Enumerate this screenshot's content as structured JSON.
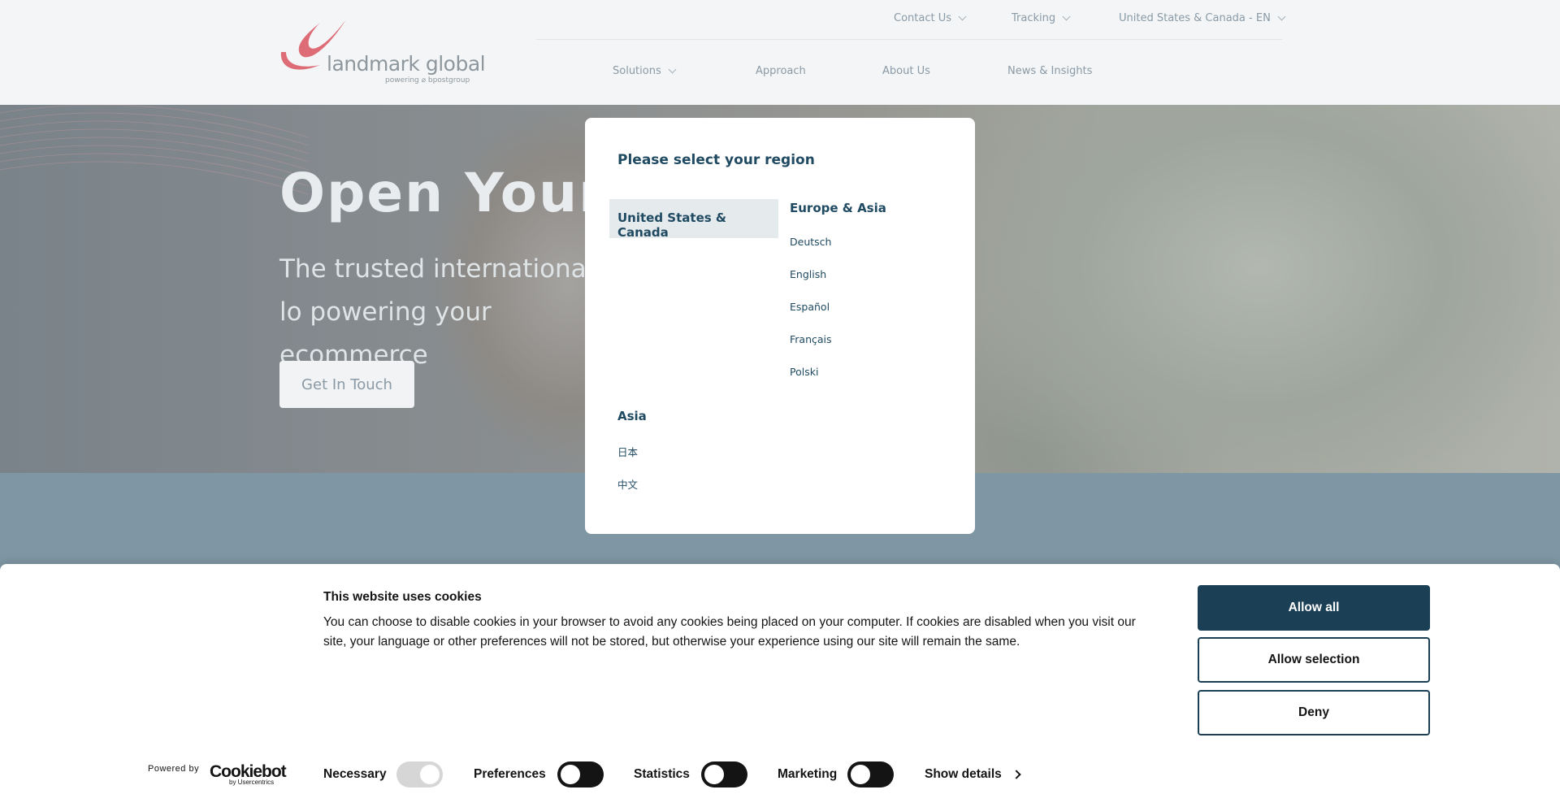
{
  "header": {
    "logo_text": "landmark global",
    "logo_sub": "powering ⌀ bpostgroup",
    "top_nav": [
      {
        "label": "Contact Us",
        "has_dropdown": true
      },
      {
        "label": "Tracking",
        "has_dropdown": true
      },
      {
        "label": "United States & Canada - EN",
        "has_dropdown": true
      }
    ],
    "main_nav": [
      {
        "label": "Solutions",
        "has_dropdown": true
      },
      {
        "label": "Approach",
        "has_dropdown": false
      },
      {
        "label": "About Us",
        "has_dropdown": false
      },
      {
        "label": "News & Insights",
        "has_dropdown": false
      }
    ]
  },
  "hero": {
    "title": "Open Your W",
    "subtitle": "The trusted international lo powering your ecommerce",
    "cta_label": "Get In Touch"
  },
  "region_modal": {
    "title": "Please select your region",
    "active_region": "United States & Canada",
    "groups": [
      {
        "title": "Europe & Asia",
        "languages": [
          "Deutsch",
          "English",
          "Español",
          "Français",
          "Polski"
        ]
      },
      {
        "title": "Asia",
        "languages": [
          "日本",
          "中文"
        ]
      }
    ]
  },
  "cookie_banner": {
    "title": "This website uses cookies",
    "text": "You can choose to disable cookies in your browser to avoid any cookies being placed on your computer. If cookies are disabled when you visit our site, your language or other preferences will not be stored, but otherwise your experience using our site will remain the same.",
    "buttons": {
      "allow_all": "Allow all",
      "allow_selection": "Allow selection",
      "deny": "Deny"
    },
    "powered_by": "Powered by",
    "brand": "Cookiebot",
    "brand_sub": "by Usercentrics",
    "categories": [
      {
        "label": "Necessary",
        "state": "on",
        "disabled": true
      },
      {
        "label": "Preferences",
        "state": "off",
        "disabled": false
      },
      {
        "label": "Statistics",
        "state": "off",
        "disabled": false
      },
      {
        "label": "Marketing",
        "state": "off",
        "disabled": false
      }
    ],
    "show_details": "Show details"
  },
  "colors": {
    "brand_red": "#d9535f",
    "dark_blue": "#1b3f55",
    "modal_text": "#1f4a61",
    "header_bg": "#f3f5f6",
    "nav_text": "#8a9aa6"
  }
}
